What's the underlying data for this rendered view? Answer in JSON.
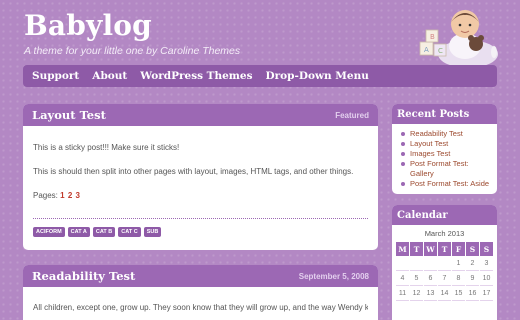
{
  "header": {
    "site_title": "Babylog",
    "site_description": "A theme for your little one by Caroline Themes",
    "mascot_icon": "baby-with-teddy-and-blocks"
  },
  "nav": {
    "items": [
      {
        "label": "Support"
      },
      {
        "label": "About"
      },
      {
        "label": "WordPress Themes"
      },
      {
        "label": "Drop-Down Menu"
      }
    ]
  },
  "posts": [
    {
      "title": "Layout Test",
      "meta": "Featured",
      "para1": "This is a sticky post!!! Make sure it sticks!",
      "para2": "This is should then split into other pages with layout, images, HTML tags, and other things.",
      "pages_label": "Pages:",
      "pages": [
        "1",
        "2",
        "3"
      ],
      "tags": [
        "ACIFORM",
        "CAT A",
        "CAT B",
        "CAT C",
        "SUB"
      ]
    },
    {
      "title": "Readability Test",
      "meta": "September 5, 2008",
      "excerpt": "All children, except one, grow up. They soon know that they will grow up, and the way Wendy knew"
    }
  ],
  "sidebar": {
    "recent_title": "Recent Posts",
    "recent_items": [
      "Readability Test",
      "Layout Test",
      "Images Test",
      "Post Format Test: Gallery",
      "Post Format Test: Aside"
    ],
    "calendar_title": "Calendar",
    "calendar_caption": "March 2013",
    "weekdays": [
      "M",
      "T",
      "W",
      "T",
      "F",
      "S",
      "S"
    ],
    "weeks": [
      [
        "",
        "",
        "",
        "",
        "1",
        "2",
        "3"
      ],
      [
        "4",
        "5",
        "6",
        "7",
        "8",
        "9",
        "10"
      ],
      [
        "11",
        "12",
        "13",
        "14",
        "15",
        "16",
        "17"
      ]
    ]
  },
  "colors": {
    "background": "#b388c4",
    "bar": "#9c68b4",
    "nav": "#8e5aa7",
    "link": "#9c4a2f",
    "page_link": "#c0392b"
  }
}
